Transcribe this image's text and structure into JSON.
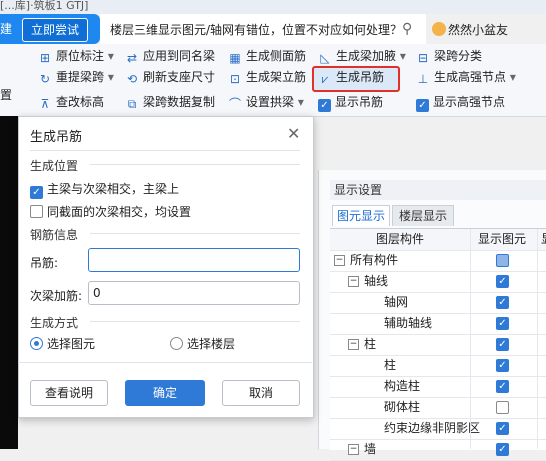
{
  "window": {
    "title": "[...库]·筑板1 GTJ]"
  },
  "promo": {
    "left_text": "建",
    "button_label": "立即尝试",
    "search_text": "楼层三维显示图元/轴网有错位，位置不对应如何处理？",
    "user_name": "然然小盆友"
  },
  "ribbon": {
    "row1": [
      {
        "icon": "align-icon",
        "label": "原位标注",
        "has_arrow": true
      },
      {
        "icon": "apply-icon",
        "label": "应用到同名梁"
      },
      {
        "icon": "side-rebar-icon",
        "label": "生成侧面筋"
      },
      {
        "icon": "haunch-icon",
        "label": "生成梁加腋",
        "has_arrow": true
      },
      {
        "icon": "span-class-icon",
        "label": "梁跨分类"
      }
    ],
    "row2": [
      {
        "icon": "relift-icon",
        "label": "重提梁跨",
        "has_arrow": true
      },
      {
        "icon": "refresh-icon",
        "label": "刷新支座尺寸"
      },
      {
        "icon": "frame-rebar-icon",
        "label": "生成架立筋"
      },
      {
        "icon": "hanger-icon",
        "label": "生成吊筋"
      },
      {
        "icon": "strong-node-icon",
        "label": "生成高强节点",
        "has_arrow": true
      }
    ],
    "row3": [
      {
        "icon": "check-elev-icon",
        "label": "查改标高"
      },
      {
        "icon": "copy-data-icon",
        "label": "梁跨数据复制"
      },
      {
        "icon": "arch-icon",
        "label": "设置拱梁",
        "has_arrow": true
      }
    ],
    "show_hanger": "显示吊筋",
    "show_strong_node": "显示高强节点",
    "left_strip_text": "置"
  },
  "dialog": {
    "title": "生成吊筋",
    "section_position": "生成位置",
    "opt_main_secondary": "主梁与次梁相交，主梁上",
    "opt_main_secondary_checked": true,
    "opt_same_section": "同截面的次梁相交，均设置",
    "opt_same_section_checked": false,
    "section_rebar": "钢筋信息",
    "hanger_label": "吊筋:",
    "hanger_value": "",
    "secondary_label": "次梁加筋:",
    "secondary_value": "0",
    "section_method": "生成方式",
    "radio_select_element": "选择图元",
    "radio_select_floor": "选择楼层",
    "selected_method": "选择图元",
    "btn_help": "查看说明",
    "btn_ok": "确定",
    "btn_cancel": "取消"
  },
  "display_panel": {
    "header": "显示设置",
    "tabs": [
      "图元显示",
      "楼层显示"
    ],
    "active_tab": "图元显示",
    "columns": [
      "图层构件",
      "显示图元",
      "显"
    ],
    "rows": [
      {
        "label": "所有构件",
        "level": 0,
        "expander": "−",
        "checked": "partial"
      },
      {
        "label": "轴线",
        "level": 1,
        "expander": "−",
        "checked": true
      },
      {
        "label": "轴网",
        "level": 2,
        "expander": "",
        "checked": true
      },
      {
        "label": "辅助轴线",
        "level": 2,
        "expander": "",
        "checked": true
      },
      {
        "label": "柱",
        "level": 1,
        "expander": "−",
        "checked": true
      },
      {
        "label": "柱",
        "level": 2,
        "expander": "",
        "checked": true
      },
      {
        "label": "构造柱",
        "level": 2,
        "expander": "",
        "checked": true
      },
      {
        "label": "砌体柱",
        "level": 2,
        "expander": "",
        "checked": false
      },
      {
        "label": "约束边缘非阴影区",
        "level": 2,
        "expander": "",
        "checked": true
      },
      {
        "label": "墙",
        "level": 1,
        "expander": "−",
        "checked": true
      }
    ]
  },
  "colors": {
    "accent": "#2f7ad6",
    "highlight_border": "#e0302a",
    "promo_blue": "#1e87f0"
  }
}
